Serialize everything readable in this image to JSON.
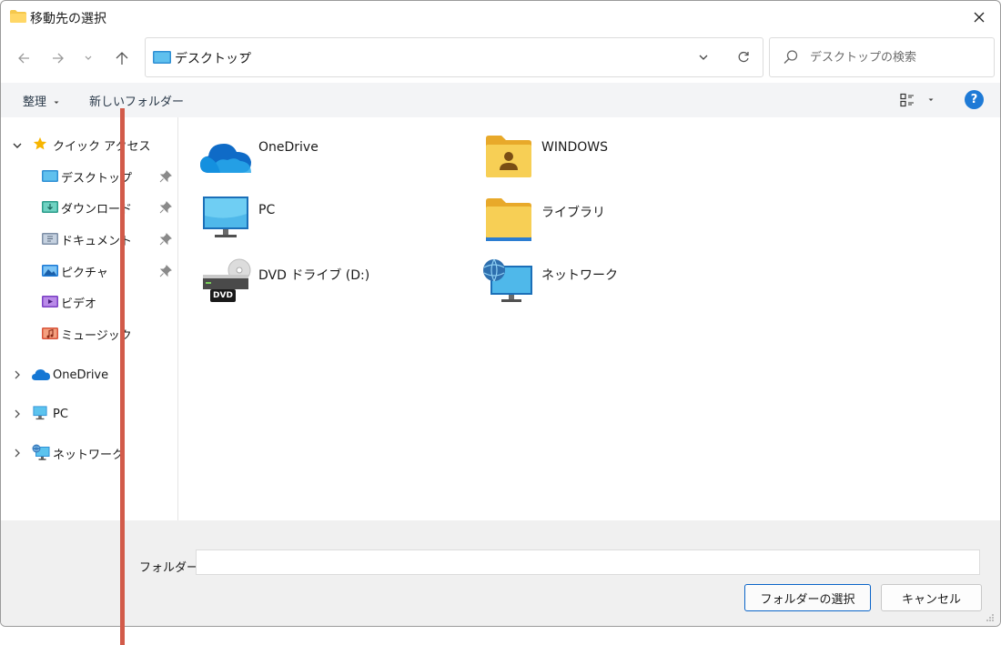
{
  "window": {
    "title": "移動先の選択"
  },
  "nav": {
    "address_path": "デスクトップ",
    "address_separator": "›",
    "search_placeholder": "デスクトップの検索"
  },
  "toolbar": {
    "organize_label": "整理",
    "new_folder_label": "新しいフォルダー",
    "help_label": "?"
  },
  "sidebar": {
    "quick_access": {
      "label": "クイック アクセス",
      "items": [
        {
          "label": "デスクトップ",
          "icon": "desktop-folder-icon"
        },
        {
          "label": "ダウンロード",
          "icon": "download-folder-icon"
        },
        {
          "label": "ドキュメント",
          "icon": "documents-folder-icon"
        },
        {
          "label": "ピクチャ",
          "icon": "pictures-folder-icon"
        },
        {
          "label": "ビデオ",
          "icon": "videos-folder-icon"
        },
        {
          "label": "ミュージック",
          "icon": "music-folder-icon"
        }
      ]
    },
    "roots": [
      {
        "label": "OneDrive",
        "icon": "onedrive-cloud-icon"
      },
      {
        "label": "PC",
        "icon": "pc-monitor-icon"
      },
      {
        "label": "ネットワーク",
        "icon": "network-icon"
      }
    ]
  },
  "content": {
    "items": [
      {
        "label": "OneDrive",
        "icon": "onedrive-cloud-icon"
      },
      {
        "label": "WINDOWS",
        "icon": "user-folder-icon"
      },
      {
        "label": "PC",
        "icon": "pc-monitor-icon"
      },
      {
        "label": "ライブラリ",
        "icon": "library-folder-icon"
      },
      {
        "label": "DVD ドライブ (D:)",
        "icon": "dvd-drive-icon"
      },
      {
        "label": "ネットワーク",
        "icon": "network-icon"
      }
    ],
    "dvd_badge": "DVD"
  },
  "footer": {
    "folder_label": "フォルダー:",
    "folder_value": "",
    "select_button": "フォルダーの選択",
    "cancel_button": "キャンセル"
  },
  "colors": {
    "accent": "#1e7ad6",
    "folder_yellow": "#f5c84c",
    "annotation_line": "#d25b4a"
  }
}
